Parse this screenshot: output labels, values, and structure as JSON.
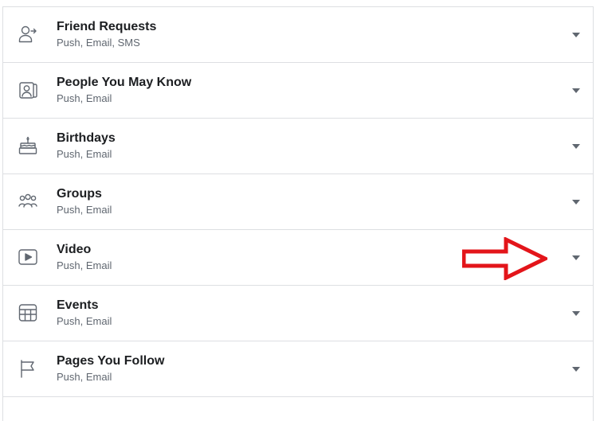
{
  "notification_settings": [
    {
      "title": "Friend Requests",
      "channels": "Push, Email, SMS",
      "icon": "friend-request-icon"
    },
    {
      "title": "People You May Know",
      "channels": "Push, Email",
      "icon": "people-you-may-know-icon"
    },
    {
      "title": "Birthdays",
      "channels": "Push, Email",
      "icon": "birthday-cake-icon"
    },
    {
      "title": "Groups",
      "channels": "Push, Email",
      "icon": "groups-icon"
    },
    {
      "title": "Video",
      "channels": "Push, Email",
      "icon": "video-play-icon"
    },
    {
      "title": "Events",
      "channels": "Push, Email",
      "icon": "calendar-icon"
    },
    {
      "title": "Pages You Follow",
      "channels": "Push, Email",
      "icon": "flag-icon"
    }
  ],
  "annotation": {
    "color": "#e3151a",
    "icon": "red-arrow-annotation"
  },
  "colors": {
    "title": "#1c1e21",
    "subtitle": "#606770",
    "divider": "#dddfe2",
    "caret": "#606770"
  }
}
